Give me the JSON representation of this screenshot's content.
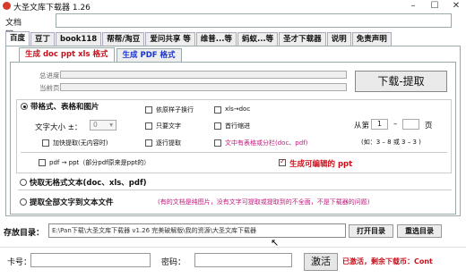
{
  "window": {
    "title": "大圣文库下载器 1.26",
    "minimize": "–",
    "maximize": "☐",
    "close": "✕"
  },
  "url": {
    "label": "文档网址：",
    "value": ""
  },
  "tabs": [
    {
      "label": "百度",
      "active": true
    },
    {
      "label": "豆丁"
    },
    {
      "label": "book118"
    },
    {
      "label": "帮帮/淘豆"
    },
    {
      "label": "爱问共享 等"
    },
    {
      "label": "维普...等"
    },
    {
      "label": "蚂蚁...等"
    },
    {
      "label": "圣才下载器"
    },
    {
      "label": "说明"
    },
    {
      "label": "免责声明"
    }
  ],
  "subtabs": [
    {
      "label": "生成 doc ppt xls 格式",
      "active": true
    },
    {
      "label": "生成 PDF 格式"
    }
  ],
  "progress": {
    "total_label": "总进度：",
    "current_label": "当前页：",
    "total_fraction": 0,
    "current_fraction": 0
  },
  "extract_button": "下载-提取",
  "options": {
    "mode_images": "带格式、表格和图片",
    "font_size_label": "文字大小 ±：",
    "font_size_value": "0",
    "retain_line_break": "依原样子换行",
    "xls_to_doc": "xls→doc",
    "only_text": "只要文字",
    "first_indent": "首行缩进",
    "add_speed": "加快提取(无内容时)",
    "line_by_line": "逐行提取",
    "table_split": "文中有表格或分栏(doc、pdf)",
    "page_from_label": "从第",
    "page_from": "1",
    "page_dash": "–",
    "page_to": "",
    "page_unit": "页",
    "page_hint": "(如：3 – 8  或 3 – 3 )",
    "pdf_to_ppt": "pdf → ppt（部分pdf原来是ppt的）",
    "editable_ppt": "生成可编辑的 ppt",
    "mode_no_format": "快取无格式文本(doc、xls、pdf)",
    "mode_all_text": "提取全部文字到文本文件",
    "all_text_note": "(有的文档是纯图片，没有文字可提取或提取到的不全面，不是下载器的问题)"
  },
  "save": {
    "label": "存放目录：",
    "path": "E:\\Pan下载\\大圣文库下载器 v1.26 完美破解版\\我的资源\\大圣文库下载器",
    "open_button": "打开目录",
    "reselect_button": "重选目录"
  },
  "activation": {
    "card_label": "卡号：",
    "password_label": "密码：",
    "activate_button": "激活",
    "status": "已激活，剩余下载币：Cont"
  }
}
